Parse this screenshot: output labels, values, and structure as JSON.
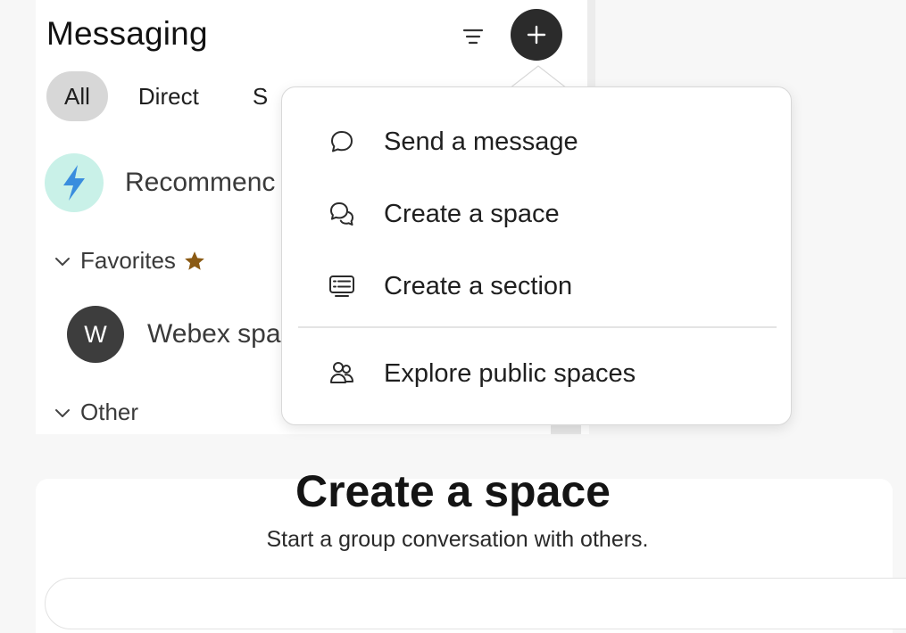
{
  "header": {
    "title": "Messaging",
    "filter_icon": "filter-lines-icon",
    "new_icon": "plus-icon"
  },
  "tabs": [
    {
      "label": "All",
      "active": true
    },
    {
      "label": "Direct",
      "active": false
    },
    {
      "label": "S",
      "active": false
    }
  ],
  "recommended": {
    "label": "Recommenc",
    "icon": "lightning-bolt-icon"
  },
  "favorites": {
    "label": "Favorites",
    "star_icon": "star-icon"
  },
  "favorite_spaces": [
    {
      "initial": "W",
      "label": "Webex spa"
    }
  ],
  "other": {
    "label": "Other"
  },
  "menu": {
    "items": [
      {
        "label": "Send a message",
        "icon": "chat-bubble-icon"
      },
      {
        "label": "Create a space",
        "icon": "chat-bubbles-icon"
      },
      {
        "label": "Create a section",
        "icon": "list-section-icon"
      },
      {
        "label": "Explore public spaces",
        "icon": "people-group-icon"
      }
    ]
  },
  "create_space": {
    "title": "Create a space",
    "subtitle": "Start a group conversation with others.",
    "input_placeholder": ""
  },
  "colors": {
    "accent_dark": "#2b2b2b",
    "recommended_bg": "#c9f1e8",
    "bolt": "#3a8dde",
    "star": "#8a5a14"
  }
}
